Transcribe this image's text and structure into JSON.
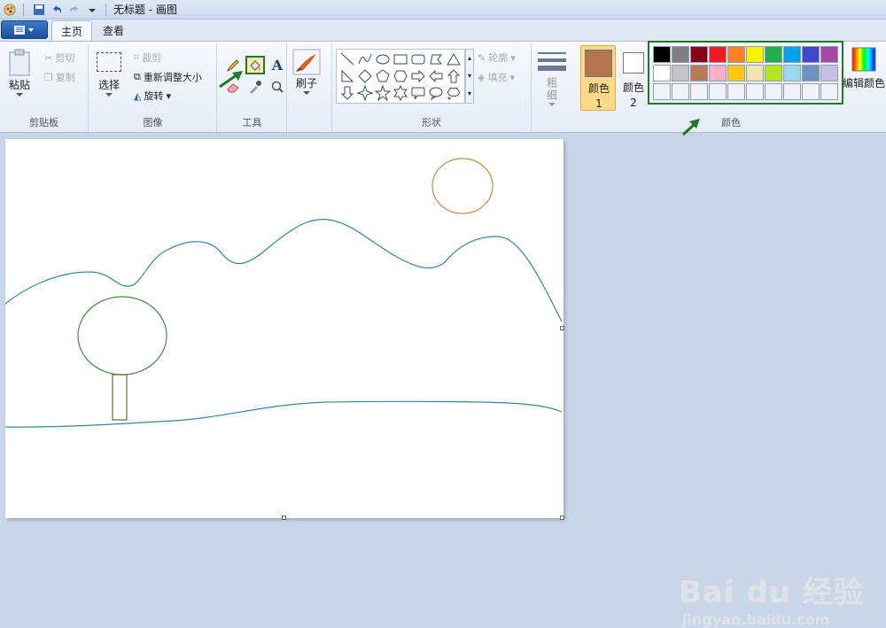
{
  "app": {
    "title": "无标题 - 画图"
  },
  "tabs": [
    {
      "label": "主页"
    },
    {
      "label": "查看"
    }
  ],
  "clipboard": {
    "paste": "粘贴",
    "cut": "剪切",
    "copy": "复制",
    "group": "剪贴板"
  },
  "image": {
    "select": "选择",
    "crop": "裁剪",
    "resize": "重新调整大小",
    "rotate": "旋转",
    "group": "图像"
  },
  "tools": {
    "group": "工具",
    "selected": "fill-tool"
  },
  "brushes": {
    "label": "刷子"
  },
  "shapes": {
    "outline": "轮廓",
    "fill": "填充",
    "group": "形状"
  },
  "size": {
    "label": "粗细"
  },
  "colors": {
    "color1": "颜色 1",
    "color2": "颜色 2",
    "edit": "编辑颜色",
    "group": "颜色",
    "color1_value": "#b5724f",
    "color2_value": "#ffffff",
    "palette": [
      "#000000",
      "#7f7f7f",
      "#880015",
      "#ed1c24",
      "#ff7f27",
      "#fff200",
      "#22b14c",
      "#00a2e8",
      "#3f48cc",
      "#a349a4",
      "#ffffff",
      "#c3c3c3",
      "#b97a57",
      "#ffaec9",
      "#ffc90e",
      "#efe4b0",
      "#b5e61d",
      "#99d9ea",
      "#7092be",
      "#c8bfe7",
      "#f0f4f9",
      "#f0f4f9",
      "#f0f4f9",
      "#f0f4f9",
      "#f0f4f9",
      "#f0f4f9",
      "#f0f4f9",
      "#f0f4f9",
      "#f0f4f9",
      "#f0f4f9"
    ]
  },
  "watermark": {
    "brand": "Bai du 经验",
    "url": "jingyan.baidu.com"
  }
}
